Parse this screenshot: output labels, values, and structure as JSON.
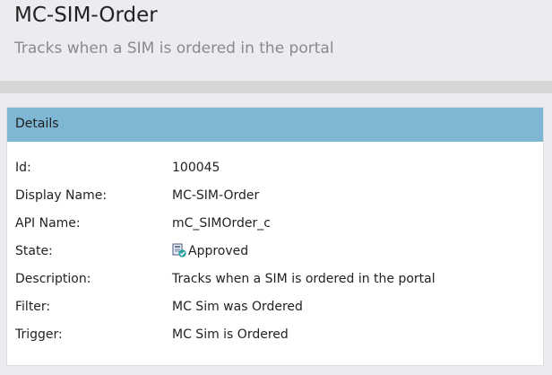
{
  "header": {
    "title": "MC-SIM-Order",
    "subtitle": "Tracks when a SIM is ordered in the portal"
  },
  "details": {
    "title": "Details",
    "rows": [
      {
        "label": "Id:",
        "value": "100045"
      },
      {
        "label": "Display Name:",
        "value": "MC-SIM-Order"
      },
      {
        "label": "API Name:",
        "value": "mC_SIMOrder_c"
      },
      {
        "label": "State:",
        "value": "Approved",
        "icon": "approved-state-icon"
      },
      {
        "label": "Description:",
        "value": "Tracks when a SIM is ordered in the portal"
      },
      {
        "label": "Filter:",
        "value": "MC Sim was Ordered"
      },
      {
        "label": "Trigger:",
        "value": "MC Sim is Ordered"
      }
    ]
  },
  "colors": {
    "header_bg": "#ecebf0",
    "details_header_bg": "#7eb6d3",
    "approved_check": "#2aa0a0"
  }
}
